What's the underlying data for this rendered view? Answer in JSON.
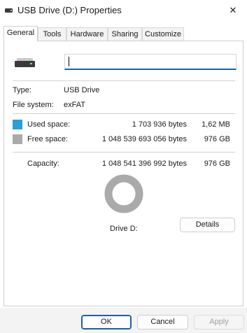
{
  "window": {
    "title": "USB Drive (D:) Properties",
    "close_glyph": "✕"
  },
  "tabs": [
    {
      "label": "General",
      "active": true
    },
    {
      "label": "Tools",
      "active": false
    },
    {
      "label": "Hardware",
      "active": false
    },
    {
      "label": "Sharing",
      "active": false
    },
    {
      "label": "Customize",
      "active": false
    }
  ],
  "general": {
    "drive_icon": "usb-drive-icon",
    "volume_label_value": "",
    "type_label": "Type:",
    "type_value": "USB Drive",
    "fs_label": "File system:",
    "fs_value": "exFAT",
    "used_label": "Used space:",
    "used_bytes": "1 703 936 bytes",
    "used_size": "1,62 MB",
    "free_label": "Free space:",
    "free_bytes": "1 048 539 693 056 bytes",
    "free_size": "976 GB",
    "capacity_label": "Capacity:",
    "capacity_bytes": "1 048 541 396 992 bytes",
    "capacity_size": "976 GB",
    "drive_label": "Drive D:",
    "details_button": "Details",
    "used_color": "#2a9fd8",
    "free_color": "#aaaaaa",
    "used_fraction": 1.6e-06
  },
  "footer": {
    "ok": "OK",
    "cancel": "Cancel",
    "apply": "Apply"
  }
}
